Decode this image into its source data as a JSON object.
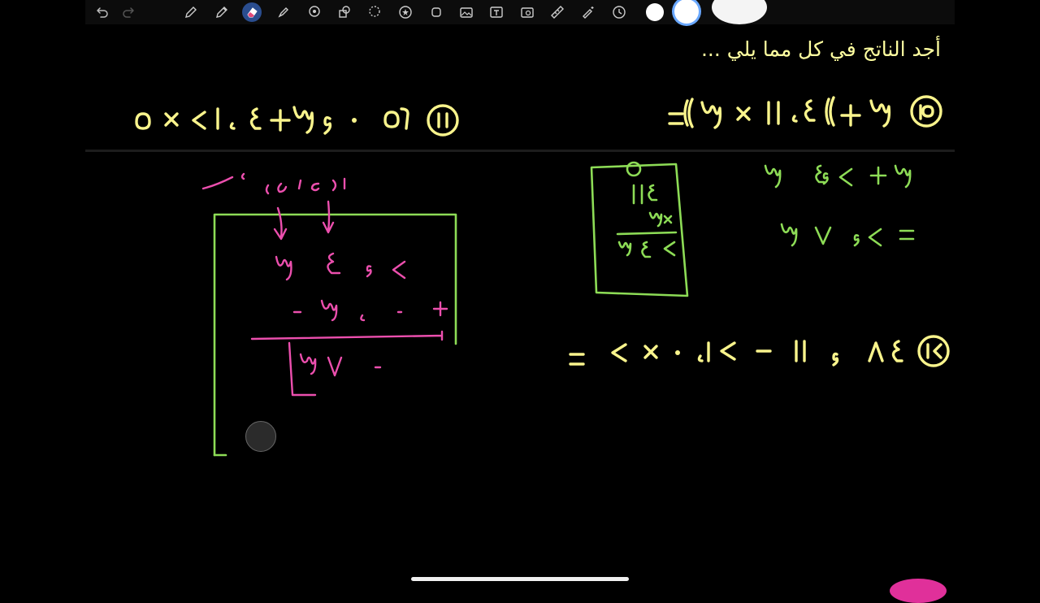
{
  "toolbar": {
    "undo_icon": "undo-icon",
    "redo_icon": "redo-icon",
    "tools": [
      "pen-icon",
      "pencil-icon",
      "eraser-icon",
      "highlighter-icon",
      "lasso-icon",
      "shapes-icon",
      "lasso-select-icon",
      "sticker-icon",
      "element-icon",
      "image-icon",
      "text-icon",
      "camera-icon",
      "ruler-icon",
      "laser-icon",
      "clock-icon"
    ],
    "active_tool": "eraser-icon",
    "swatches": [
      "#ffffff",
      "#ffffff",
      "#ffffff"
    ]
  },
  "canvas": {
    "instruction": "أجد الناتج في كل مما يلي ...",
    "ink_colors": {
      "question": "#f9f48c",
      "working": "#8ddc56",
      "annotation": "#ec4fae"
    },
    "problem_10": "١٠) ٣ + (( ٣ × ١١ ، ٤)) =",
    "problem_11": "١١) ٥٦ ، ٣ + ٤ ، ٢١ × ٥",
    "problem_12": "١٢) ٨٤ ، ١١ − ٢١ ، ٠ × ٢ =",
    "place_value_label": "احاد عشرات"
  }
}
